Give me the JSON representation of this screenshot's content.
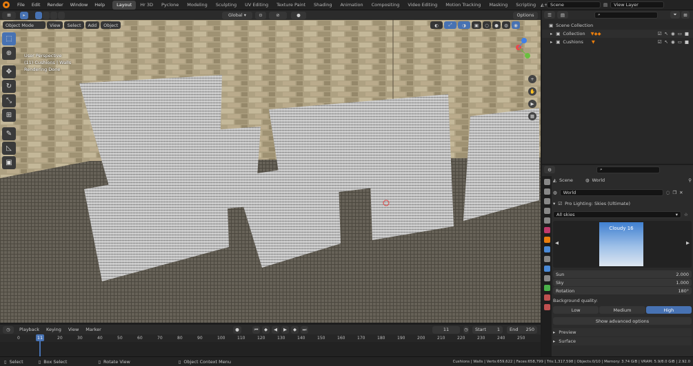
{
  "topbar": {
    "menu": [
      "File",
      "Edit",
      "Render",
      "Window",
      "Help"
    ],
    "tabs": [
      "Layout",
      "Hr 3D",
      "Pyclone",
      "Modeling",
      "Sculpting",
      "UV Editing",
      "Texture Paint",
      "Shading",
      "Animation",
      "Compositing",
      "Video Editing",
      "Motion Tracking",
      "Masking",
      "Scripting"
    ],
    "active_tab": "Layout",
    "scene": "Scene",
    "view_layer": "View Layer"
  },
  "viewport_header": {
    "mode": "Object Mode",
    "menus": [
      "View",
      "Select",
      "Add",
      "Object"
    ],
    "transform": "Global",
    "options": "Options"
  },
  "viewport_info": {
    "line1": "User Perspective",
    "line2": "(11) Cushions | Walls",
    "line3": "Rendering Done"
  },
  "outliner": {
    "search_placeholder": "",
    "items": [
      {
        "label": "Scene Collection"
      },
      {
        "label": "Collection"
      },
      {
        "label": "Cushions"
      }
    ]
  },
  "properties": {
    "scene_tab": "Scene",
    "world_tab": "World",
    "world_name": "World",
    "addon_panel": "Pro Lighting: Skies (Ultimate)",
    "category": "All skies",
    "preview_label": "Cloudy 16",
    "sun_label": "Sun",
    "sun_value": "2.000",
    "sky_label": "Sky",
    "sky_value": "1.000",
    "rotation_label": "Rotation",
    "rotation_value": "180°",
    "bg_quality_label": "Background quality:",
    "quality_options": [
      "Low",
      "Medium",
      "High"
    ],
    "active_quality": "High",
    "advanced_button": "Show advanced options",
    "preview_panel": "Preview",
    "surface_panel": "Surface"
  },
  "timeline_header": {
    "menus": [
      "Playback",
      "Keying",
      "View",
      "Marker"
    ],
    "current_frame": "11",
    "start_label": "Start",
    "start_value": "1",
    "end_label": "End",
    "end_value": "250"
  },
  "timeline": {
    "ticks": [
      "0",
      "10",
      "20",
      "30",
      "40",
      "50",
      "60",
      "70",
      "80",
      "90",
      "100",
      "110",
      "120",
      "130",
      "140",
      "150",
      "160",
      "170",
      "180",
      "190",
      "200",
      "210",
      "220",
      "230",
      "240",
      "250"
    ],
    "current": "11"
  },
  "statusbar": {
    "select": "Select",
    "box_select": "Box Select",
    "rotate_view": "Rotate View",
    "context_menu": "Object Context Menu",
    "stats": "Cushions | Walls | Verts:659,622 | Faces:658,799 | Tris:1,317,598 | Objects:0/10 | Memory: 3.74 GiB | VRAM: 5.9/8.0 GiB | 2.92.0"
  },
  "colors": {
    "accent": "#4772b3",
    "orange": "#e87d0d",
    "bg": "#1d1d1d"
  }
}
